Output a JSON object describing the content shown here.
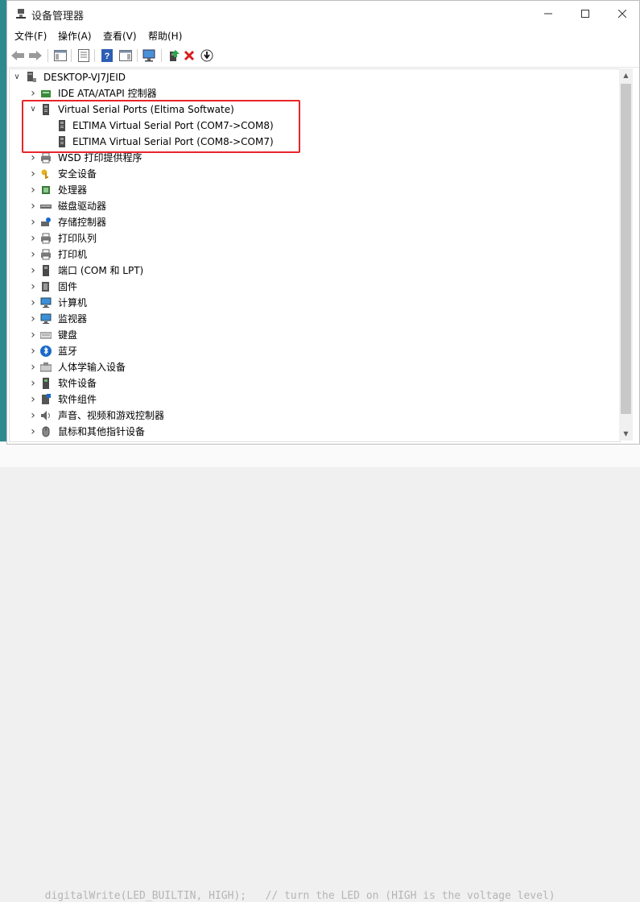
{
  "window": {
    "title": "设备管理器"
  },
  "menu": [
    "文件(F)",
    "操作(A)",
    "查看(V)",
    "帮助(H)"
  ],
  "background_code": "  digitalWrite(LED_BUILTIN, HIGH);   // turn the LED on (HIGH is the voltage level)",
  "tree": {
    "root": "DESKTOP-VJ7JEID",
    "items": [
      {
        "label": "IDE ATA/ATAPI 控制器",
        "icon": "ide-controller-icon",
        "expanded": false
      },
      {
        "label": "Virtual Serial Ports (Eltima Softwate)",
        "icon": "serial-port-icon",
        "expanded": true
      },
      {
        "label": "ELTIMA Virtual Serial Port (COM7->COM8)",
        "icon": "serial-port-icon",
        "child": true
      },
      {
        "label": "ELTIMA Virtual Serial Port (COM8->COM7)",
        "icon": "serial-port-icon",
        "child": true
      },
      {
        "label": "WSD 打印提供程序",
        "icon": "printer-icon",
        "expanded": false
      },
      {
        "label": "安全设备",
        "icon": "key-icon",
        "expanded": false
      },
      {
        "label": "处理器",
        "icon": "processor-icon",
        "expanded": false
      },
      {
        "label": "磁盘驱动器",
        "icon": "disk-drive-icon",
        "expanded": false
      },
      {
        "label": "存储控制器",
        "icon": "storage-controller-icon",
        "expanded": false
      },
      {
        "label": "打印队列",
        "icon": "print-queue-icon",
        "expanded": false
      },
      {
        "label": "打印机",
        "icon": "printer-icon",
        "expanded": false
      },
      {
        "label": "端口 (COM 和 LPT)",
        "icon": "port-icon",
        "expanded": false
      },
      {
        "label": "固件",
        "icon": "firmware-icon",
        "expanded": false
      },
      {
        "label": "计算机",
        "icon": "computer-icon",
        "expanded": false
      },
      {
        "label": "监视器",
        "icon": "monitor-icon",
        "expanded": false
      },
      {
        "label": "键盘",
        "icon": "keyboard-icon",
        "expanded": false
      },
      {
        "label": "蓝牙",
        "icon": "bluetooth-icon",
        "expanded": false
      },
      {
        "label": "人体学输入设备",
        "icon": "hid-icon",
        "expanded": false
      },
      {
        "label": "软件设备",
        "icon": "software-device-icon",
        "expanded": false
      },
      {
        "label": "软件组件",
        "icon": "software-component-icon",
        "expanded": false
      },
      {
        "label": "声音、视频和游戏控制器",
        "icon": "sound-icon",
        "expanded": false
      },
      {
        "label": "鼠标和其他指针设备",
        "icon": "mouse-icon",
        "expanded": false
      }
    ]
  },
  "colors": {
    "highlight": "#e8252a",
    "accent": "#1b6ac9"
  }
}
